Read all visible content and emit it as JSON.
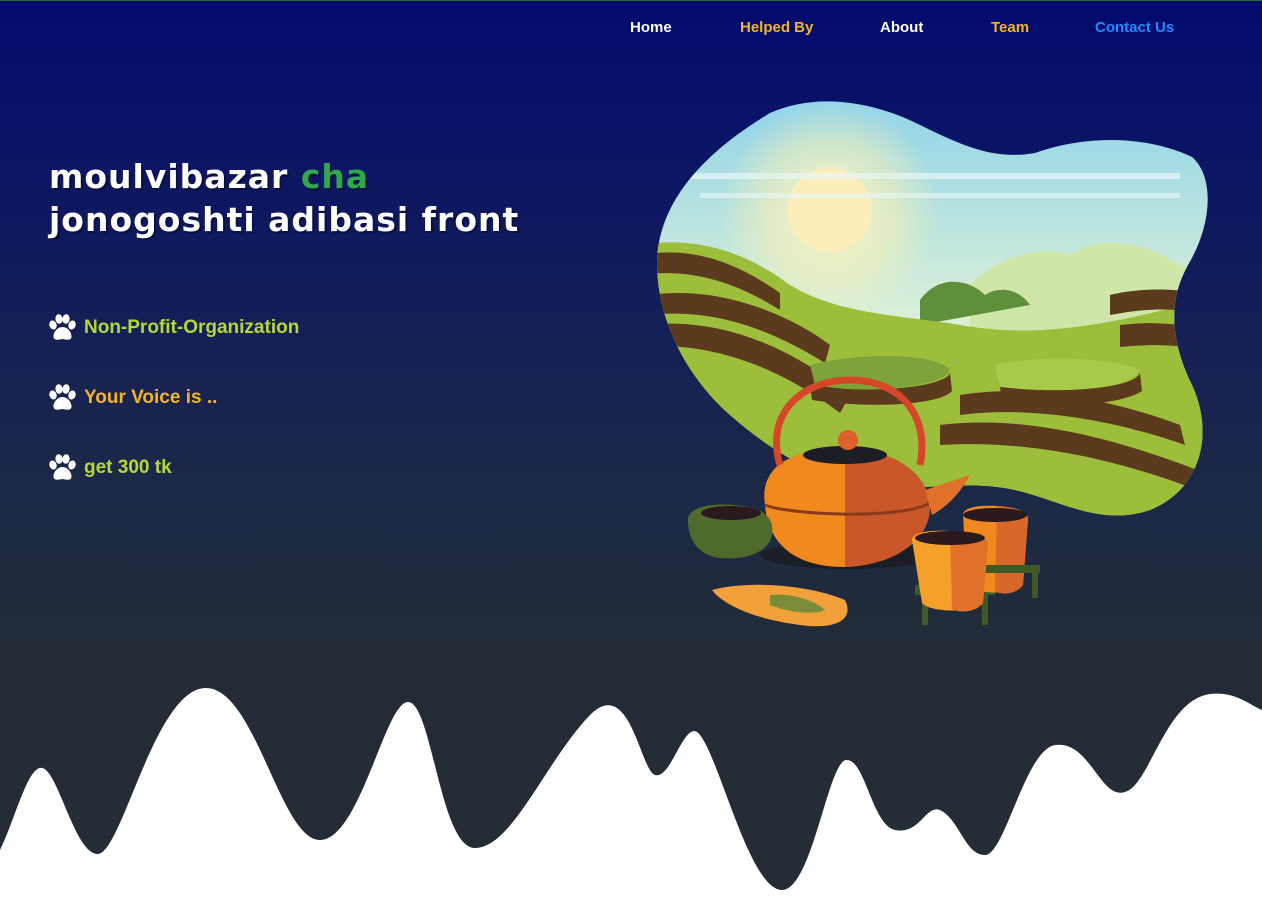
{
  "colors": {
    "nav_white": "#ffffff",
    "nav_gold": "#f5b325",
    "nav_blue": "#1f8bff",
    "feature_green": "#b7d733",
    "feature_gold": "#f5b325",
    "accent_green": "#2ea84a"
  },
  "nav": {
    "home": "Home",
    "helped_by": "Helped By",
    "about": "About",
    "team": "Team",
    "contact": "Contact Us"
  },
  "hero": {
    "title_part1": "moulvibazar ",
    "title_accent": "cha",
    "title_line2": "jonogoshti adibasi front"
  },
  "features": [
    {
      "icon": "paw-icon",
      "label": "Non-Profit-Organization"
    },
    {
      "icon": "paw-icon",
      "label": "Your Voice is .."
    },
    {
      "icon": "paw-icon",
      "label": "get 300 tk"
    }
  ],
  "illustration": {
    "subject": "tea-garden-teapot-illustration"
  }
}
